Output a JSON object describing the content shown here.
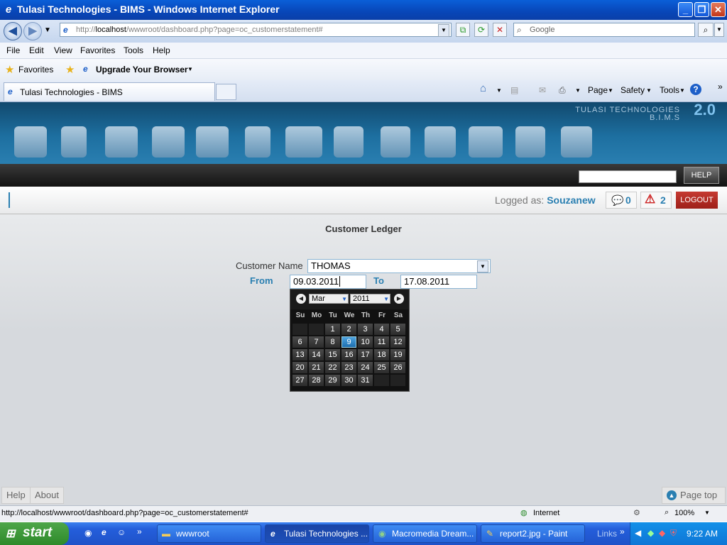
{
  "window": {
    "title": "Tulasi Technologies - BIMS - Windows Internet Explorer"
  },
  "browser": {
    "address": {
      "prefix": "http://",
      "host": "localhost",
      "path": "/wwwroot/dashboard.php?page=oc_customerstatement#"
    },
    "search_placeholder": "Google",
    "menu": [
      "File",
      "Edit",
      "View",
      "Favorites",
      "Tools",
      "Help"
    ],
    "favorites_label": "Favorites",
    "upgrade_label": "Upgrade Your Browser",
    "tab_title": "Tulasi Technologies - BIMS",
    "commands": {
      "page": "Page",
      "safety": "Safety",
      "tools": "Tools"
    }
  },
  "app": {
    "brand_name": "TULASI TECHNOLOGIES",
    "brand_sub": "B.I.M.S",
    "brand_version": "2.0",
    "help_button": "HELP",
    "logged_label": "Logged as:",
    "username": "Souzanew",
    "messages_count": "0",
    "alerts_count": "2",
    "logout_button": "LOGOUT",
    "page_title": "Customer Ledger",
    "form": {
      "customer_label": "Customer Name",
      "customer_value": "THOMAS",
      "from_label": "From",
      "from_value": "09.03.2011",
      "to_label": "To",
      "to_value": "17.08.2011"
    },
    "calendar": {
      "month": "Mar",
      "year": "2011",
      "weekdays": [
        "Su",
        "Mo",
        "Tu",
        "We",
        "Th",
        "Fr",
        "Sa"
      ],
      "selected_day": 9
    },
    "footer": {
      "help": "Help",
      "about": "About",
      "page_top": "Page top"
    }
  },
  "statusbar": {
    "url": "http://localhost/wwwroot/dashboard.php?page=oc_customerstatement#",
    "zone": "Internet",
    "zoom": "100%"
  },
  "taskbar": {
    "start": "start",
    "tasks": [
      "wwwroot",
      "Tulasi Technologies ...",
      "Macromedia Dream...",
      "report2.jpg - Paint"
    ],
    "links": "Links",
    "time": "9:22 AM"
  }
}
